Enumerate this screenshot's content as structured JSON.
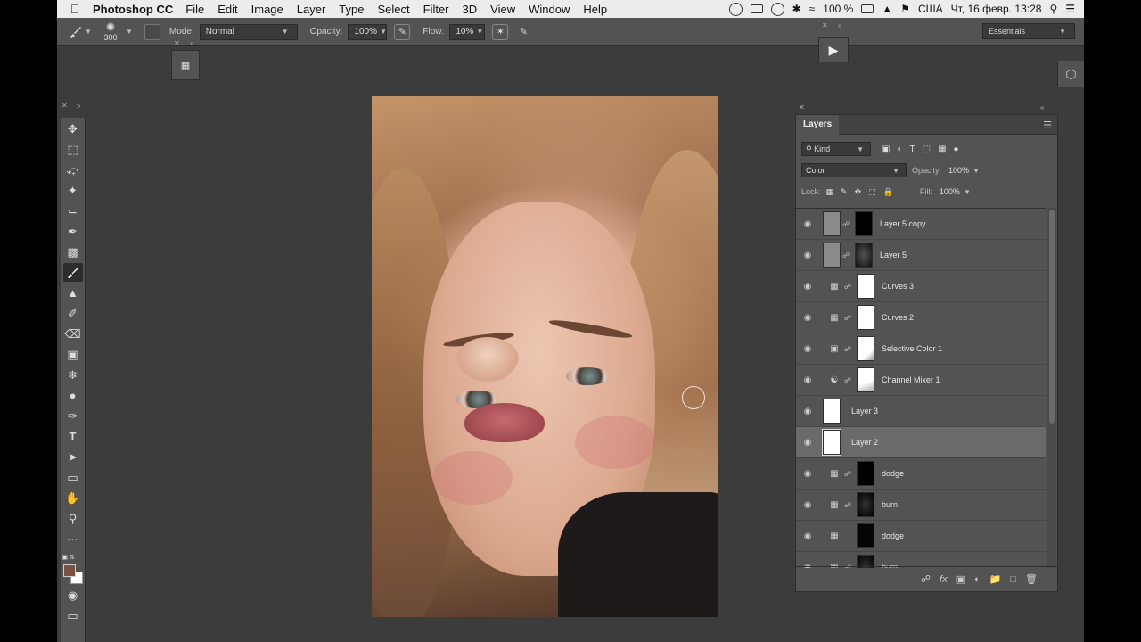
{
  "menubar": {
    "app_name": "Photoshop CC",
    "items": [
      "File",
      "Edit",
      "Image",
      "Layer",
      "Type",
      "Select",
      "Filter",
      "3D",
      "View",
      "Window",
      "Help"
    ],
    "battery": "100 %",
    "language": "США",
    "datetime": "Чт, 16 февр.  13:28"
  },
  "options": {
    "brush_size": "300",
    "mode_label": "Mode:",
    "mode_value": "Normal",
    "opacity_label": "Opacity:",
    "opacity_value": "100%",
    "flow_label": "Flow:",
    "flow_value": "10%",
    "workspace": "Essentials"
  },
  "layers_panel": {
    "title": "Layers",
    "filter_kind": "Kind",
    "blend_mode": "Color",
    "opacity_label": "Opacity:",
    "opacity_value": "100%",
    "lock_label": "Lock:",
    "fill_label": "Fill:",
    "fill_value": "100%",
    "layers": [
      {
        "name": "Layer 5 copy"
      },
      {
        "name": "Layer 5"
      },
      {
        "name": "Curves 3"
      },
      {
        "name": "Curves 2"
      },
      {
        "name": "Selective Color 1"
      },
      {
        "name": "Channel Mixer 1"
      },
      {
        "name": "Layer 3"
      },
      {
        "name": "Layer 2"
      },
      {
        "name": "dodge"
      },
      {
        "name": "burn"
      },
      {
        "name": "dodge"
      },
      {
        "name": "burn"
      }
    ]
  },
  "colors": {
    "foreground": "#7a5244",
    "background": "#ffffff"
  }
}
